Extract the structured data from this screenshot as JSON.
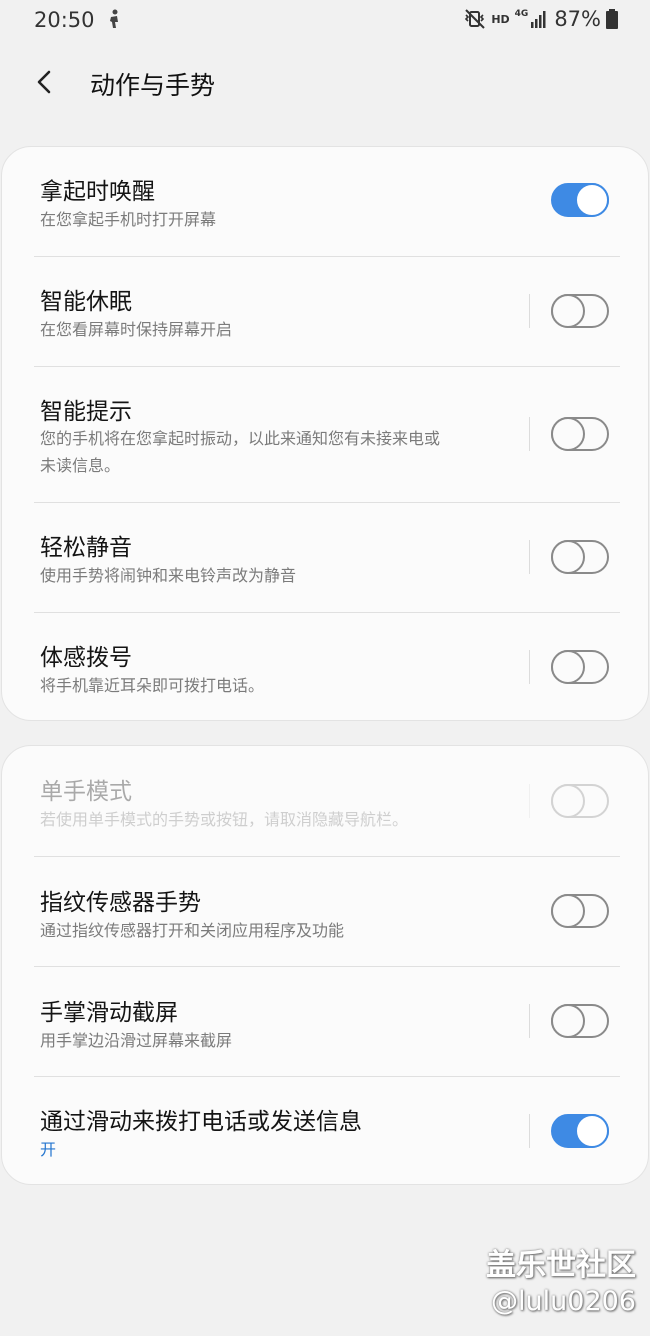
{
  "status_bar": {
    "time": "20:50",
    "hd": "HD",
    "network": "4G",
    "battery": "87%"
  },
  "header": {
    "title": "动作与手势"
  },
  "section1": [
    {
      "title": "拿起时唤醒",
      "subtitle": "在您拿起手机时打开屏幕",
      "on": true
    },
    {
      "title": "智能休眠",
      "subtitle": "在您看屏幕时保持屏幕开启",
      "on": false
    },
    {
      "title": "智能提示",
      "subtitle_lines": [
        "您的手机将在您拿起时振动，以此来通知您有未接来电或",
        "未读信息。"
      ],
      "on": false
    },
    {
      "title": "轻松静音",
      "subtitle": "使用手势将闹钟和来电铃声改为静音",
      "on": false
    },
    {
      "title": "体感拨号",
      "subtitle": "将手机靠近耳朵即可拨打电话。",
      "on": false
    }
  ],
  "section2": [
    {
      "title": "单手模式",
      "subtitle": "若使用单手模式的手势或按钮，请取消隐藏导航栏。",
      "on": false,
      "disabled": true
    },
    {
      "title": "指纹传感器手势",
      "subtitle": "通过指纹传感器打开和关闭应用程序及功能",
      "on": false
    },
    {
      "title": "手掌滑动截屏",
      "subtitle": "用手掌边沿滑过屏幕来截屏",
      "on": false
    },
    {
      "title": "通过滑动来拨打电话或发送信息",
      "subtitle": "开",
      "on": true
    }
  ],
  "watermark": {
    "line1": "盖乐世社区",
    "line2": "@lulu0206"
  },
  "colors": {
    "accent": "#3e8ae4",
    "background": "#f1f1f1",
    "card": "#fbfbfb"
  }
}
